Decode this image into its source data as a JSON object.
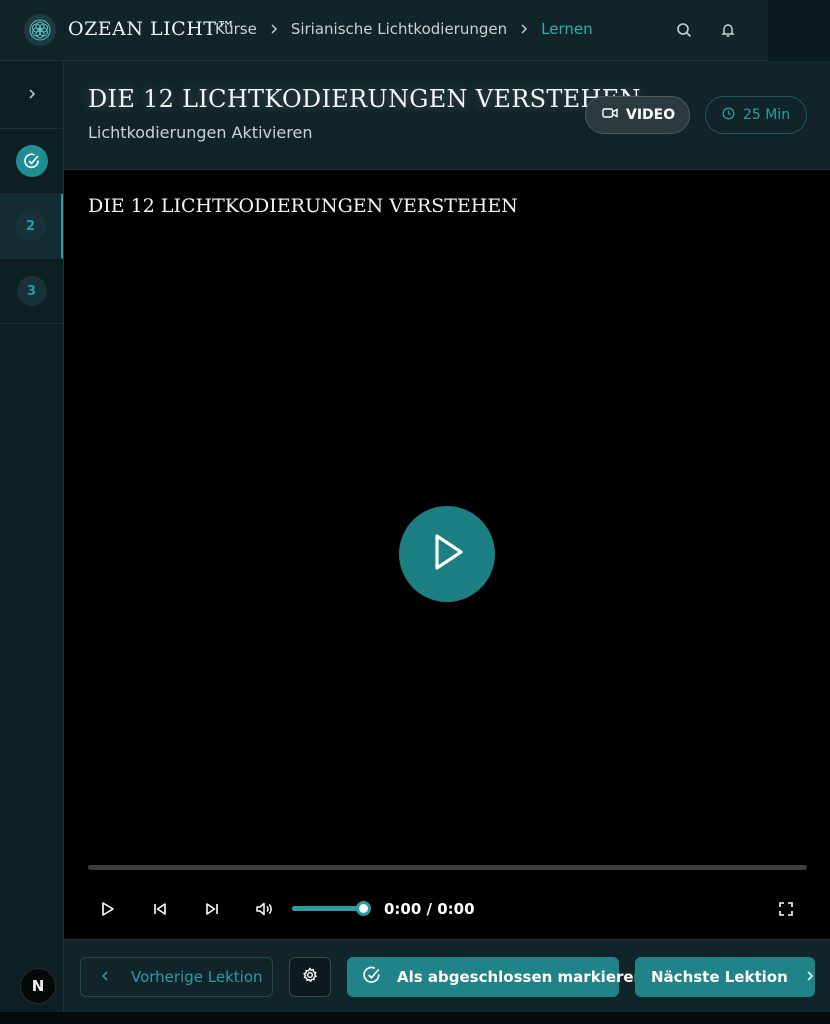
{
  "brand": {
    "name": "OZEAN LICHT™"
  },
  "breadcrumb": {
    "items": [
      "Kurse",
      "Sirianische Lichtkodierungen",
      "Lernen"
    ]
  },
  "lesson": {
    "title": "DIE 12 LICHTKODIERUNGEN VERSTEHEN",
    "subtitle": "Lichtkodierungen Aktivieren",
    "type_label": "VIDEO",
    "duration_label": "25 Min"
  },
  "sidebar": {
    "steps": [
      {
        "label": "",
        "status": "completed"
      },
      {
        "label": "2",
        "status": "current"
      },
      {
        "label": "3",
        "status": "upcoming"
      }
    ],
    "avatar_initial": "N"
  },
  "video": {
    "title": "DIE 12 LICHTKODIERUNGEN VERSTEHEN",
    "time": "0:00 / 0:00",
    "progress": 0,
    "volume": 1.0
  },
  "footer": {
    "prev_label": "Vorherige Lektion",
    "complete_label": "Als abgeschlossen markieren",
    "next_label": "Nächste Lektion"
  },
  "colors": {
    "accent": "#2a9da0",
    "accent_button": "#1f8388",
    "background": "#0b1a1f"
  }
}
